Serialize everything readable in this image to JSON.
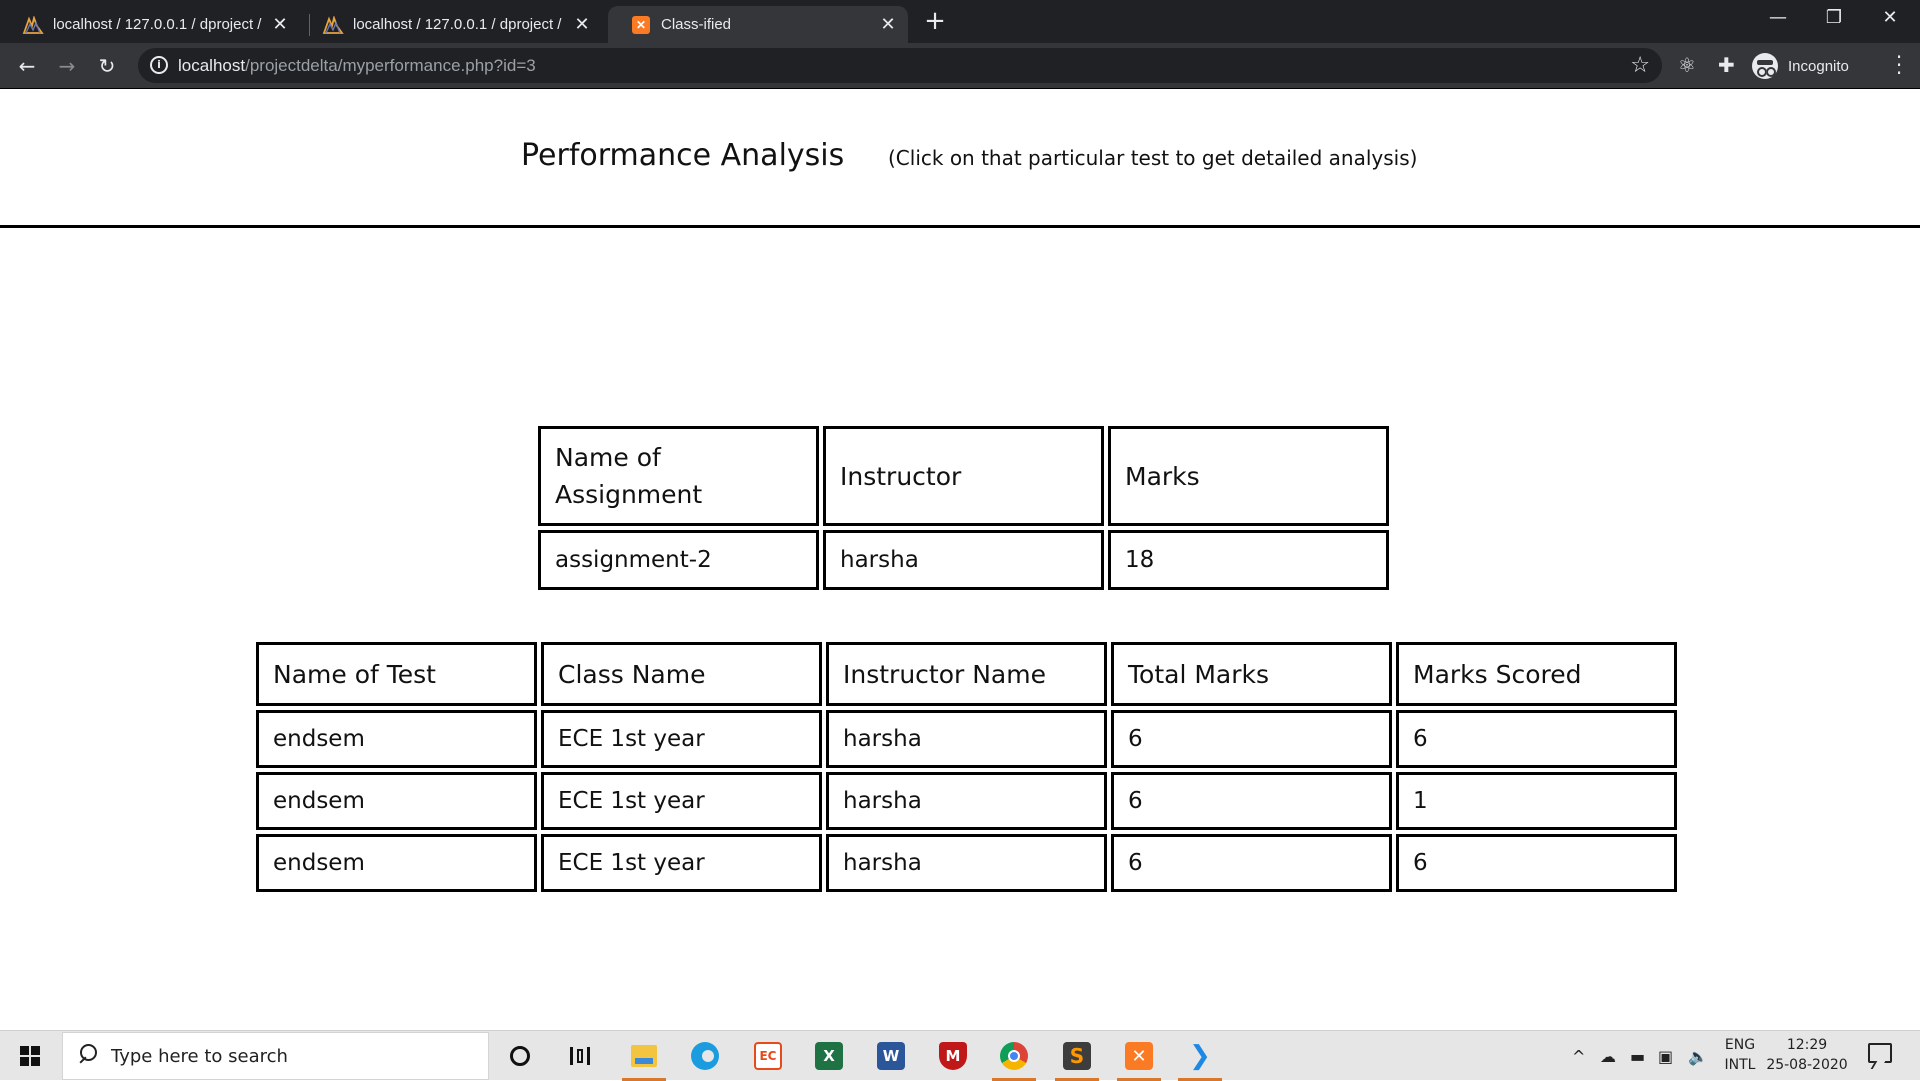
{
  "browser": {
    "tabs": [
      {
        "title": "localhost / 127.0.0.1 / dproject / ",
        "icon": "phpmyadmin-icon",
        "active": false
      },
      {
        "title": "localhost / 127.0.0.1 / dproject / ",
        "icon": "phpmyadmin-icon",
        "active": false
      },
      {
        "title": "Class-ified",
        "icon": "xampp-icon",
        "active": true
      }
    ],
    "url_host": "localhost",
    "url_path": "/projectdelta/myperformance.php?id=3",
    "profile_label": "Incognito",
    "colors": {
      "chrome_dark": "#202124",
      "chrome_toolbar": "#35363a",
      "text": "#e8eaed"
    }
  },
  "page": {
    "title": "Performance Analysis",
    "hint": "(Click on that particular test to get detailed analysis)"
  },
  "assignments": {
    "headers": [
      "Name of Assignment",
      "Instructor",
      "Marks"
    ],
    "rows": [
      [
        "assignment-2",
        "harsha",
        "18"
      ]
    ]
  },
  "tests": {
    "headers": [
      "Name of Test",
      "Class Name",
      "Instructor Name",
      "Total Marks",
      "Marks Scored"
    ],
    "rows": [
      [
        "endsem",
        "ECE 1st year",
        "harsha",
        "6",
        "6"
      ],
      [
        "endsem",
        "ECE 1st year",
        "harsha",
        "6",
        "1"
      ],
      [
        "endsem",
        "ECE 1st year",
        "harsha",
        "6",
        "6"
      ]
    ]
  },
  "taskbar": {
    "search_placeholder": "Type here to search",
    "apps": [
      "cortana-icon",
      "task-view-icon",
      "file-explorer-icon",
      "edge-icon",
      "office-icon",
      "excel-icon",
      "word-icon",
      "mcafee-icon",
      "chrome-icon",
      "sublime-text-icon",
      "xampp-icon",
      "vscode-icon"
    ],
    "lang_line1": "ENG",
    "lang_line2": "INTL",
    "time": "12:29",
    "date": "25-08-2020"
  }
}
